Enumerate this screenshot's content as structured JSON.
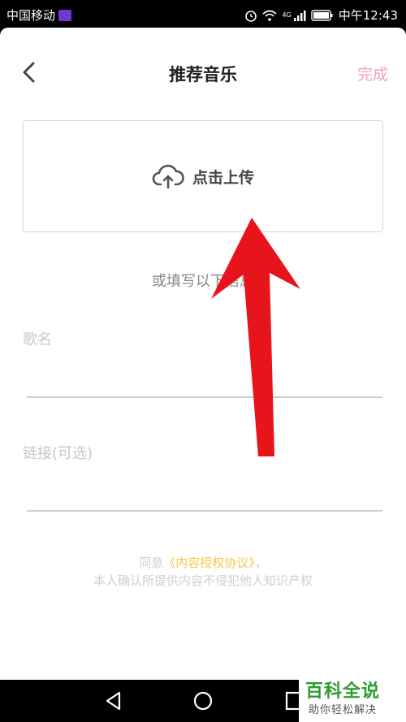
{
  "status_bar": {
    "carrier": "中国移动",
    "network_type": "4G",
    "time": "中午12:43",
    "icons": [
      "alarm-icon",
      "wifi-icon",
      "signal-icon",
      "battery-icon"
    ]
  },
  "header": {
    "title": "推荐音乐",
    "done_label": "完成"
  },
  "upload": {
    "label": "点击上传",
    "icon": "cloud-upload-icon"
  },
  "form": {
    "or_fill": "或填写以下信息",
    "song_label": "歌名",
    "song_value": "",
    "link_label": "链接(可选)",
    "link_value": ""
  },
  "agreement": {
    "prefix": "同意",
    "link": "《内容授权协议》",
    "suffix": "，",
    "line2": "本人确认所提供内容不侵犯他人知识产权"
  },
  "watermark": {
    "main": "百科全说",
    "sub": "助你轻松解决"
  },
  "colors": {
    "done": "#f3a2b6",
    "link": "#f2c94c",
    "arrow": "#e8141b",
    "watermark": "#2e9c2e"
  }
}
